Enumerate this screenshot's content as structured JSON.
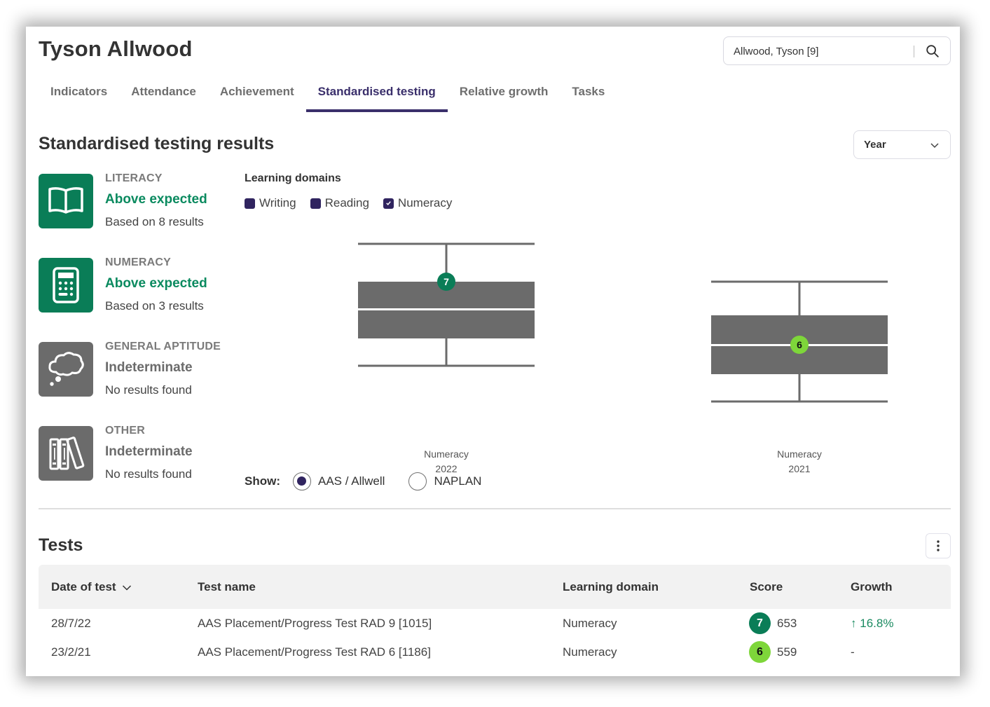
{
  "header": {
    "student_name": "Tyson Allwood",
    "search": {
      "value": "Allwood, Tyson [9]",
      "icon": "search-icon"
    }
  },
  "tabs": [
    {
      "label": "Indicators",
      "active": false
    },
    {
      "label": "Attendance",
      "active": false
    },
    {
      "label": "Achievement",
      "active": false
    },
    {
      "label": "Standardised testing",
      "active": true
    },
    {
      "label": "Relative growth",
      "active": false
    },
    {
      "label": "Tasks",
      "active": false
    }
  ],
  "results": {
    "title": "Standardised testing results",
    "period_select": {
      "value": "Year",
      "icon": "chevron-down-icon"
    },
    "cards": [
      {
        "category": "LITERACY",
        "status": "Above expected",
        "status_tone": "positive",
        "detail": "Based on 8 results",
        "icon": "open-book-icon",
        "color": "#0a7d57"
      },
      {
        "category": "NUMERACY",
        "status": "Above expected",
        "status_tone": "positive",
        "detail": "Based on 3 results",
        "icon": "calculator-icon",
        "color": "#0a7d57"
      },
      {
        "category": "GENERAL APTITUDE",
        "status": "Indeterminate",
        "status_tone": "neutral",
        "detail": "No results found",
        "icon": "thought-bubble-icon",
        "color": "#6b6b6b"
      },
      {
        "category": "OTHER",
        "status": "Indeterminate",
        "status_tone": "neutral",
        "detail": "No results found",
        "icon": "books-icon",
        "color": "#6b6b6b"
      }
    ],
    "learning_domains": {
      "title": "Learning domains",
      "items": [
        {
          "label": "Writing",
          "checked": false
        },
        {
          "label": "Reading",
          "checked": false
        },
        {
          "label": "Numeracy",
          "checked": true
        }
      ]
    },
    "show": {
      "label": "Show:",
      "options": [
        {
          "label": "AAS / Allwell",
          "selected": true
        },
        {
          "label": "NAPLAN",
          "selected": false
        }
      ]
    }
  },
  "chart_data": {
    "type": "boxplot",
    "title": "",
    "xlabel": "",
    "ylabel": "",
    "grid": false,
    "y_scale": "band (relative, no axis labels shown)",
    "ylim": [
      0,
      10
    ],
    "categories": [
      "Numeracy\n2022",
      "Numeracy\n2021"
    ],
    "series": [
      {
        "name": "Numeracy 2022",
        "domain": "Numeracy",
        "year": "2022",
        "whisker_high": 9.4,
        "q3": 7.6,
        "median": 6.3,
        "q1": 4.9,
        "whisker_low": 3.6,
        "student_band": 7,
        "student_band_position": 7.6,
        "marker_color": "#0a7d57",
        "marker_text_color": "#ffffff"
      },
      {
        "name": "Numeracy 2021",
        "domain": "Numeracy",
        "year": "2021",
        "whisker_high": 7.6,
        "q3": 6.0,
        "median": 4.6,
        "q1": 3.2,
        "whisker_low": 1.9,
        "student_band": 6,
        "student_band_position": 4.6,
        "marker_color": "#7ed63a",
        "marker_text_color": "#111111"
      }
    ],
    "box_color": "#6b6b6b"
  },
  "tests": {
    "title": "Tests",
    "menu_icon": "more-vertical-icon",
    "columns": [
      "Date of test",
      "Test name",
      "Learning domain",
      "Score",
      "Growth"
    ],
    "sort_column": "Date of test",
    "rows": [
      {
        "date": "28/7/22",
        "name": "AAS Placement/Progress Test RAD 9 [1015]",
        "domain": "Numeracy",
        "band": "7",
        "band_color": "#0a7d57",
        "band_text_color": "#ffffff",
        "score": "653",
        "growth": "16.8%",
        "growth_direction": "up"
      },
      {
        "date": "23/2/21",
        "name": "AAS Placement/Progress Test RAD 6 [1186]",
        "domain": "Numeracy",
        "band": "6",
        "band_color": "#7ed63a",
        "band_text_color": "#111111",
        "score": "559",
        "growth": "-",
        "growth_direction": "none"
      }
    ]
  }
}
